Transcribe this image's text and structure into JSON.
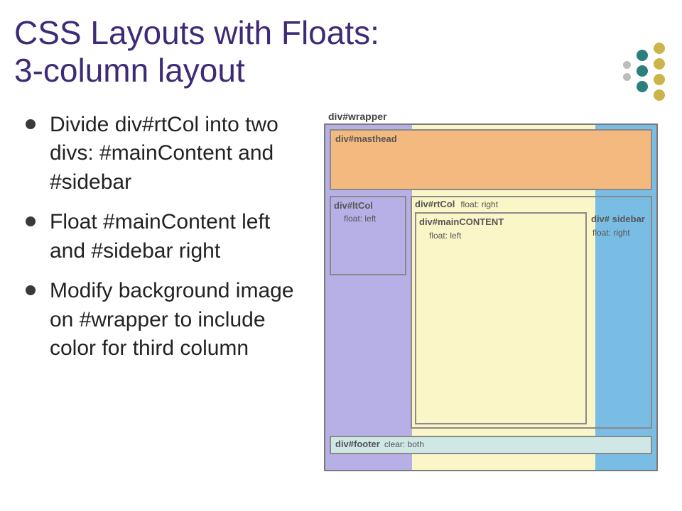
{
  "title_line1": "CSS Layouts with Floats:",
  "title_line2": "3-column layout",
  "bullets": [
    "Divide div#rtCol into two divs: #mainContent and #sidebar",
    "Float #mainContent left and #sidebar right",
    "Modify background image on #wrapper to include color for third column"
  ],
  "diagram": {
    "wrapper": "div#wrapper",
    "masthead": "div#masthead",
    "ltcol": {
      "label": "div#ltCol",
      "note": "float: left"
    },
    "rtcol": {
      "label": "div#rtCol",
      "note": "float: right"
    },
    "maincontent": {
      "label": "div#mainCONTENT",
      "note": "float: left"
    },
    "sidebar": {
      "label": "div# sidebar",
      "note": "float: right"
    },
    "footer": {
      "label": "div#footer",
      "note": "clear: both"
    }
  }
}
